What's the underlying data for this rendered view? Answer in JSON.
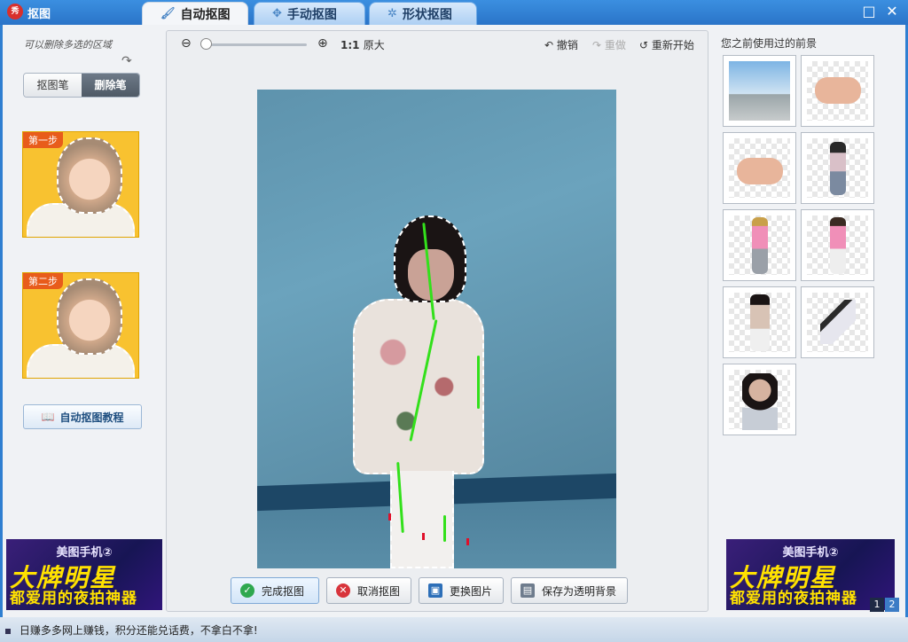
{
  "titlebar": {
    "logo": "秀",
    "title": "抠图",
    "maximize": "□",
    "close": "✕"
  },
  "tabs": [
    {
      "label": "自动抠图",
      "icon": "brush-icon",
      "glyph": "🖌"
    },
    {
      "label": "手动抠图",
      "icon": "magic-wand-icon",
      "glyph": "✥"
    },
    {
      "label": "形状抠图",
      "icon": "shape-icon",
      "glyph": "✲"
    }
  ],
  "left": {
    "hint": "可以删除多选的区域",
    "hint_arrow": "↷",
    "mode_options": [
      "抠图笔",
      "删除笔"
    ],
    "step1": "第一步",
    "step2": "第二步",
    "tutorial_glyph": "📖",
    "tutorial_label": "自动抠图教程"
  },
  "ad": {
    "line1": "美图手机②",
    "line2": "大牌明星",
    "line3": "都爱用的夜拍神器"
  },
  "toolbar": {
    "zoom_out": "⊖",
    "zoom_in": "⊕",
    "ratio": "1:1",
    "original": "原大",
    "undo_glyph": "↶",
    "undo": "撤销",
    "redo_glyph": "↷",
    "redo": "重做",
    "reset_glyph": "↺",
    "reset": "重新开始"
  },
  "buttons": {
    "done_glyph": "✓",
    "done": "完成抠图",
    "cancel_glyph": "✕",
    "cancel": "取消抠图",
    "replace_glyph": "▣",
    "replace": "更换图片",
    "save_glyph": "▤",
    "save": "保存为透明背景"
  },
  "right": {
    "title": "您之前使用过的前景",
    "pages": [
      "1",
      "2"
    ]
  },
  "status": {
    "text": "日赚多多网上赚钱，积分还能兑话费，不拿白不拿!"
  }
}
